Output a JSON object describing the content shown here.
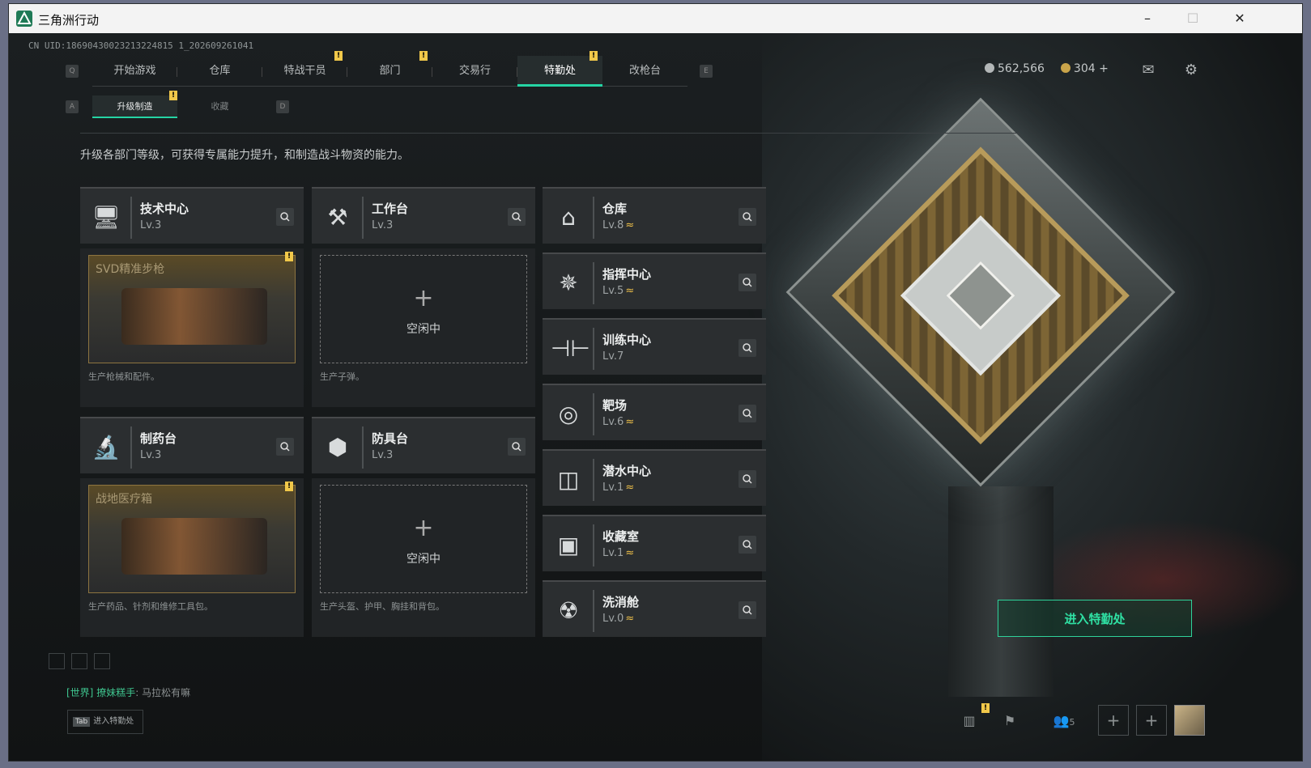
{
  "window": {
    "title": "三角洲行动",
    "controls": [
      "–",
      "☐",
      "✕"
    ]
  },
  "uid": "CN UID:18690430023213224815 1_202609261041",
  "nav": {
    "key_left": "Q",
    "key_right": "E",
    "tabs": [
      {
        "label": "开始游戏",
        "badge": false
      },
      {
        "label": "仓库",
        "badge": false
      },
      {
        "label": "特战干员",
        "badge": true
      },
      {
        "label": "部门",
        "badge": true
      },
      {
        "label": "交易行",
        "badge": false
      },
      {
        "label": "特勤处",
        "badge": true,
        "active": true
      },
      {
        "label": "改枪台",
        "badge": false
      }
    ]
  },
  "subnav": {
    "key_left": "A",
    "key_right": "D",
    "tabs": [
      {
        "label": "升级制造",
        "active": true,
        "badge": true
      },
      {
        "label": "收藏",
        "active": false
      }
    ]
  },
  "currency": {
    "silver": "562,566",
    "gold": "304",
    "gold_add": "+"
  },
  "description": "升级各部门等级，可获得专属能力提升，和制造战斗物资的能力。",
  "workshops": [
    {
      "name": "技术中心",
      "level": "Lv.3",
      "icon": "monitor-icon",
      "product": {
        "type": "item",
        "item_name": "SVD精准步枪",
        "badge": true
      },
      "desc": "生产枪械和配件。"
    },
    {
      "name": "工作台",
      "level": "Lv.3",
      "icon": "tools-icon",
      "product": {
        "type": "empty",
        "plus": "+",
        "idle_label": "空闲中"
      },
      "desc": "生产子弹。"
    },
    {
      "name": "制药台",
      "level": "Lv.3",
      "icon": "microscope-icon",
      "product": {
        "type": "item",
        "item_name": "战地医疗箱",
        "badge": true
      },
      "desc": "生产药品、针剂和维修工具包。"
    },
    {
      "name": "防具台",
      "level": "Lv.3",
      "icon": "cubes-icon",
      "product": {
        "type": "empty",
        "plus": "+",
        "idle_label": "空闲中"
      },
      "desc": "生产头盔、护甲、胸挂和背包。"
    }
  ],
  "facilities": [
    {
      "name": "仓库",
      "level": "Lv.8",
      "upgradable": true,
      "icon": "warehouse-icon"
    },
    {
      "name": "指挥中心",
      "level": "Lv.5",
      "upgradable": true,
      "icon": "command-icon"
    },
    {
      "name": "训练中心",
      "level": "Lv.7",
      "upgradable": false,
      "icon": "dumbbell-icon"
    },
    {
      "name": "靶场",
      "level": "Lv.6",
      "upgradable": true,
      "icon": "target-icon"
    },
    {
      "name": "潜水中心",
      "level": "Lv.1",
      "upgradable": true,
      "icon": "goggles-icon"
    },
    {
      "name": "收藏室",
      "level": "Lv.1",
      "upgradable": true,
      "icon": "collection-icon"
    },
    {
      "name": "洗消舱",
      "level": "Lv.0",
      "upgradable": true,
      "icon": "decon-icon"
    }
  ],
  "upgrade_glyph": "≈",
  "enter_button": "进入特勤处",
  "chat": {
    "channel": "[世界]",
    "user": "撩妹糕手",
    "message": "马拉松有嘛"
  },
  "tab_hint": {
    "key": "Tab",
    "label": "进入特勤处"
  },
  "social_count": "5"
}
